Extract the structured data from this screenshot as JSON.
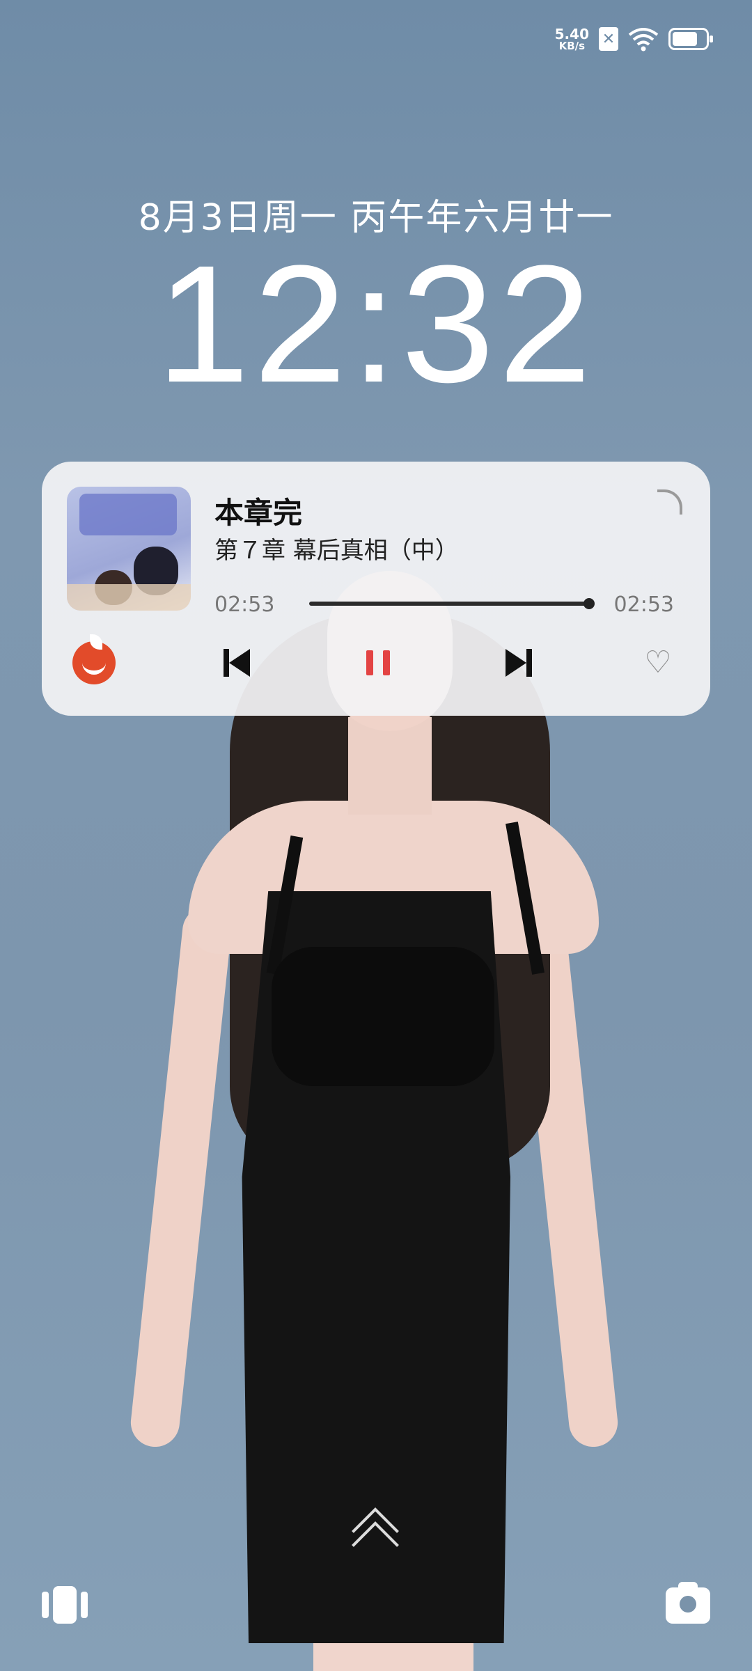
{
  "status_bar": {
    "speed_value": "5.40",
    "speed_unit": "KB/s",
    "sim_status": "x",
    "battery_level": 0.75
  },
  "lockscreen": {
    "date": "8月3日周一 丙午年六月廿一",
    "time": "12:32"
  },
  "media_card": {
    "title": "本章完",
    "subtitle": "第７章 幕后真相（中）",
    "elapsed": "02:53",
    "duration": "02:53",
    "progress": 1.0,
    "app_icon": "tomato-icon",
    "controls": {
      "prev_icon": "skip-previous-icon",
      "pause_icon": "pause-icon",
      "next_icon": "skip-next-icon",
      "like_icon": "heart-icon"
    },
    "accent_color": "#e34343"
  },
  "bottom": {
    "left_icon": "widgets-icon",
    "right_icon": "camera-icon",
    "swipe_icon": "chevron-up-icon"
  }
}
